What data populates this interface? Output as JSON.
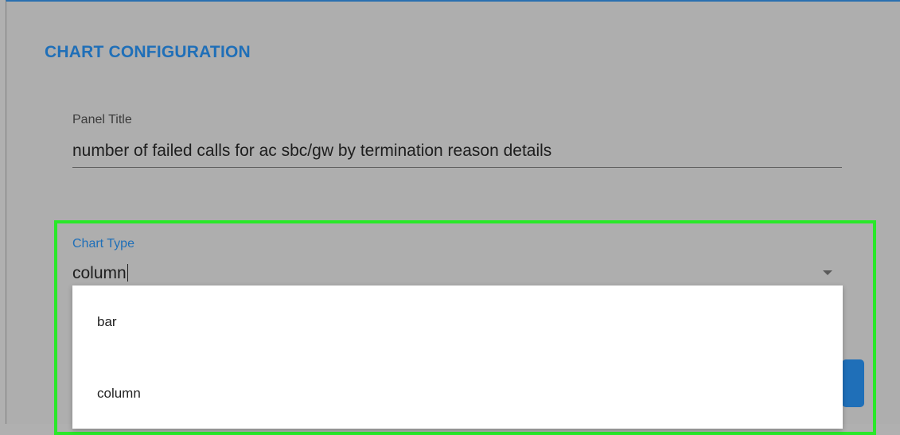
{
  "section": {
    "title": "CHART CONFIGURATION"
  },
  "panel_title": {
    "label": "Panel Title",
    "value": "number of failed calls for ac sbc/gw by termination reason details"
  },
  "chart_type": {
    "label": "Chart Type",
    "value": "column",
    "options": [
      "bar",
      "column"
    ]
  },
  "colors": {
    "accent": "#1f6fb8",
    "highlight": "#29e829",
    "backdrop": "#aeaeae"
  },
  "icons": {
    "dropdown": "chevron-down-icon"
  }
}
